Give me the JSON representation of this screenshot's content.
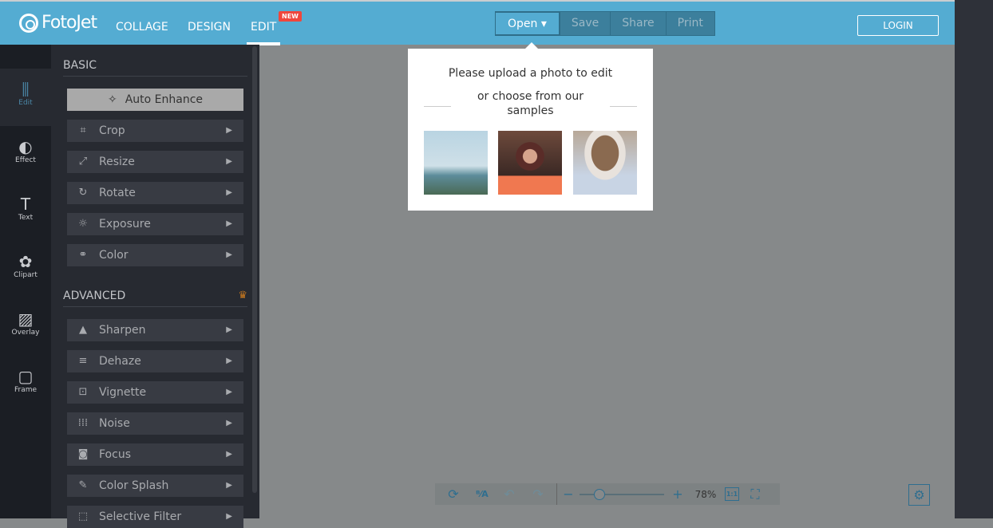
{
  "header": {
    "logo": "FotoJet",
    "nav": [
      "COLLAGE",
      "DESIGN",
      "EDIT"
    ],
    "new_badge": "NEW",
    "file": [
      "Open ▾",
      "Save",
      "Share",
      "Print"
    ],
    "login": "LOGIN"
  },
  "rail": [
    "Edit",
    "Effect",
    "Text",
    "Clipart",
    "Overlay",
    "Frame"
  ],
  "panel": {
    "basic": "BASIC",
    "auto_enhance": "Auto Enhance",
    "basic_items": [
      "Crop",
      "Resize",
      "Rotate",
      "Exposure",
      "Color"
    ],
    "advanced": "ADVANCED",
    "advanced_items": [
      "Sharpen",
      "Dehaze",
      "Vignette",
      "Noise",
      "Focus",
      "Color Splash",
      "Selective Filter"
    ]
  },
  "popup": {
    "line1": "Please upload a photo to edit",
    "line2": "or choose from our samples"
  },
  "bottom": {
    "zoom": "78%",
    "ratio": "1:1"
  }
}
